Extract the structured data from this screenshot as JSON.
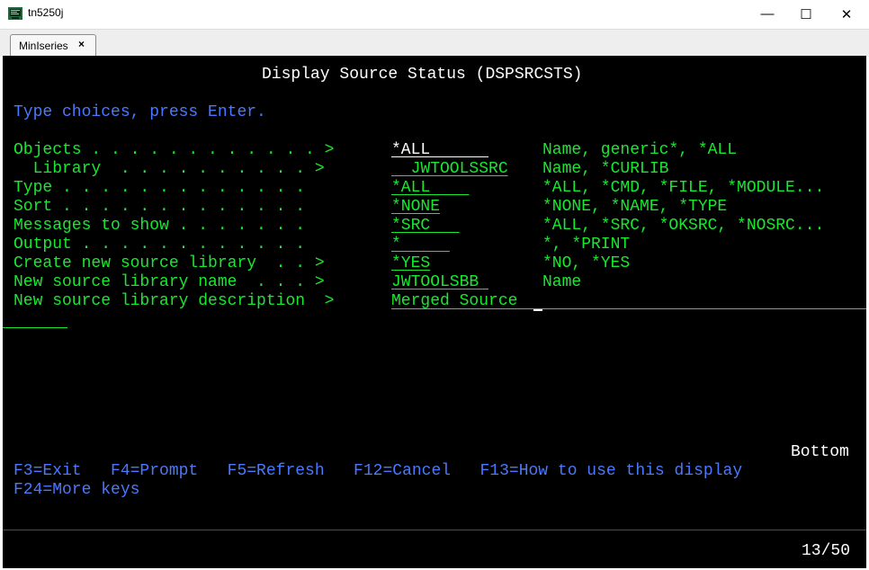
{
  "window": {
    "title": "tn5250j",
    "minimize_glyph": "—",
    "maximize_glyph": "☐",
    "close_glyph": "✕"
  },
  "tab": {
    "label": "MinIseries",
    "close_glyph": "×"
  },
  "screen": {
    "title": "Display Source Status (DSPSRCSTS)",
    "instruction": "Type choices, press Enter.",
    "prompts": [
      {
        "label": "Objects . . . . . . . . . . . . >",
        "value": "*ALL      ",
        "value_color": "white",
        "help": "Name, generic*, *ALL"
      },
      {
        "label": "  Library  . . . . . . . . . . >",
        "value": "  JWTOOLSSRC",
        "value_color": "green",
        "help": "Name, *CURLIB"
      },
      {
        "label": "Type . . . . . . . . . . . . .  ",
        "value": "*ALL    ",
        "value_color": "green",
        "help": "*ALL, *CMD, *FILE, *MODULE..."
      },
      {
        "label": "Sort . . . . . . . . . . . . .  ",
        "value": "*NONE",
        "value_color": "green",
        "help": "*NONE, *NAME, *TYPE"
      },
      {
        "label": "Messages to show . . . . . . .  ",
        "value": "*SRC   ",
        "value_color": "green",
        "help": "*ALL, *SRC, *OKSRC, *NOSRC..."
      },
      {
        "label": "Output . . . . . . . . . . . .  ",
        "value": "*     ",
        "value_color": "green",
        "help": "*, *PRINT"
      },
      {
        "label": "Create new source library  . . >",
        "value": "*YES",
        "value_color": "green",
        "help": "*NO, *YES"
      },
      {
        "label": "New source library name  . . . >",
        "value": "JWTOOLSBB ",
        "value_color": "green",
        "help": "Name"
      },
      {
        "label": "New source library description  >",
        "value": "Merged Source",
        "value_color": "green",
        "help": ""
      }
    ],
    "bottom_marker": "Bottom",
    "function_keys_line1": "F3=Exit   F4=Prompt   F5=Refresh   F12=Cancel   F13=How to use this display",
    "function_keys_line2": "F24=More keys",
    "cursor_position": "13/50"
  }
}
